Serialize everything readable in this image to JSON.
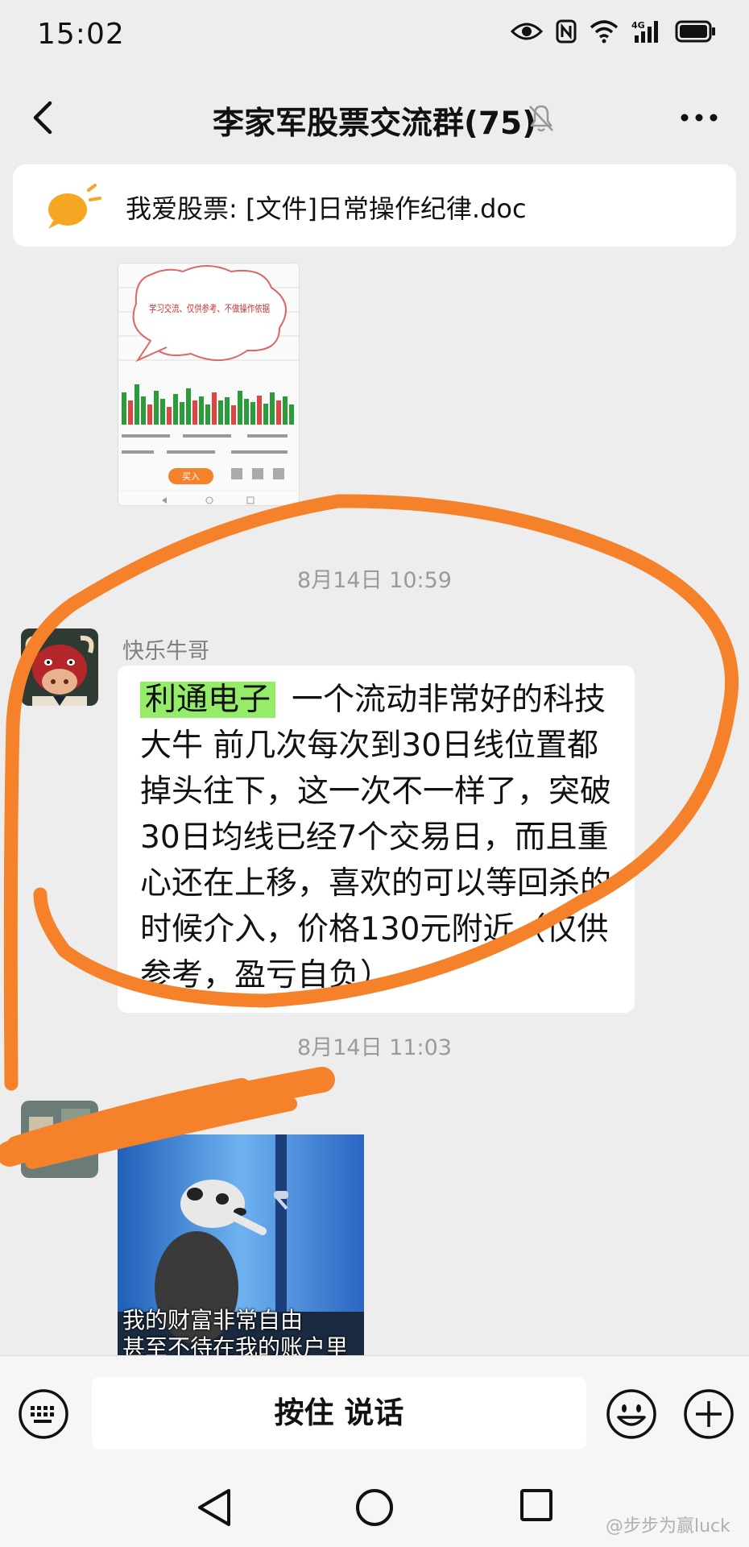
{
  "status_bar": {
    "time": "15:02"
  },
  "header": {
    "title": "李家军股票交流群(75)"
  },
  "announcement": {
    "text": "我爱股票: [文件]日常操作纪律.doc"
  },
  "chat": {
    "stock_image": {
      "bubble_text": "学习交流、仅供参考、不做操作依据",
      "bottom_button": "买入"
    },
    "timestamp_1": "8月14日 10:59",
    "message_1": {
      "sender": "快乐牛哥",
      "highlight": "利通电子",
      "text": "一个流动非常好的科技大牛 前几次每次到30日线位置都掉头往下，这一次不一样了，突破30日均线已经7个交易日，而且重心还在上移，喜欢的可以等回杀的时候介入，价格130元附近（仅供参考，盈亏自负）"
    },
    "timestamp_2": "8月14日 11:03",
    "meme": {
      "caption_line1": "我的财富非常自由",
      "caption_line2": "甚至不待在我的账户里"
    }
  },
  "input_bar": {
    "hold_to_talk": "按住 说话"
  },
  "watermark": "@步步为赢luck",
  "colors": {
    "highlight": "#95ec69",
    "annotation": "#f5822a",
    "background": "#ededed"
  }
}
